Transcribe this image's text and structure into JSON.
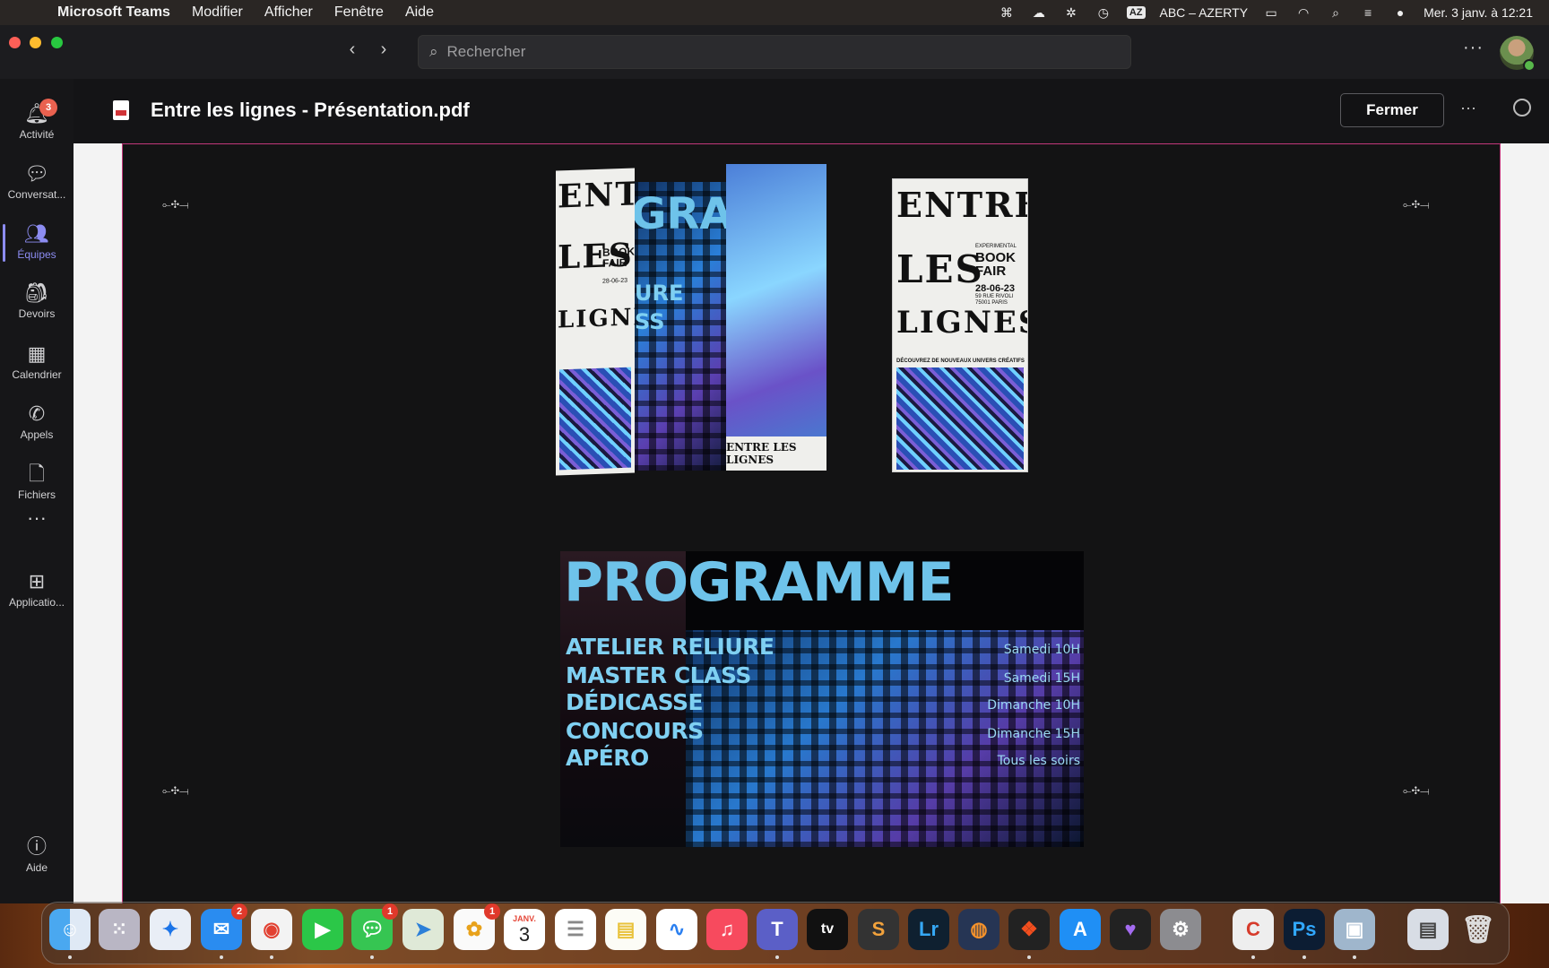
{
  "menubar": {
    "app_name": "Microsoft Teams",
    "menus": [
      "Modifier",
      "Afficher",
      "Fenêtre",
      "Aide"
    ],
    "keyboard_badge": "AZ",
    "keyboard_layout": "ABC – AZERTY",
    "datetime": "Mer. 3 janv. à 12:21"
  },
  "titlebar": {
    "search_placeholder": "Rechercher"
  },
  "sidebar": {
    "items": [
      {
        "label": "Activité",
        "icon": "bell-icon",
        "badge": "3"
      },
      {
        "label": "Conversat...",
        "icon": "chat-icon"
      },
      {
        "label": "Équipes",
        "icon": "teams-icon",
        "active": true
      },
      {
        "label": "Devoirs",
        "icon": "backpack-icon"
      },
      {
        "label": "Calendrier",
        "icon": "calendar-icon"
      },
      {
        "label": "Appels",
        "icon": "phone-icon"
      },
      {
        "label": "Fichiers",
        "icon": "file-icon"
      },
      {
        "label": "Applicatio...",
        "icon": "apps-icon"
      },
      {
        "label": "Aide",
        "icon": "help-icon"
      }
    ]
  },
  "file": {
    "title": "Entre les lignes - Présentation.pdf",
    "close_label": "Fermer"
  },
  "flyer": {
    "line1": "ENTRE",
    "line2": "LES",
    "line3": "LIGNES",
    "kicker": "EXPERIMENTAL",
    "book": "BOOK",
    "fair": "FAIR",
    "date": "28-06-23",
    "address1": "59 RUE RIVOLI",
    "address2": "75001 PARIS",
    "tagline": "DÉCOUVREZ DE NOUVEAUX UNIVERS CRÉATIFS",
    "footer_brand": "ENTRE LES LIGNES",
    "partial_gra": "GRA",
    "partial_ure": "URE",
    "partial_ss": "SS"
  },
  "programme": {
    "title": "PROGRAMME",
    "activities": [
      "ATELIER RELIURE",
      "MASTER CLASS",
      "DÉDICASSE",
      "CONCOURS",
      "APÉRO"
    ],
    "times": [
      "Samedi 10H",
      "Samedi 15H",
      "Dimanche 10H",
      "Dimanche 15H",
      "Tous les soirs"
    ]
  },
  "dock": {
    "mail_badge": "2",
    "messages_badge": "1",
    "photos_badge": "1",
    "calendar_month": "JANV.",
    "calendar_day": "3",
    "lightroom_label": "Lr",
    "photoshop_label": "Ps",
    "appletv_label": "tv"
  }
}
